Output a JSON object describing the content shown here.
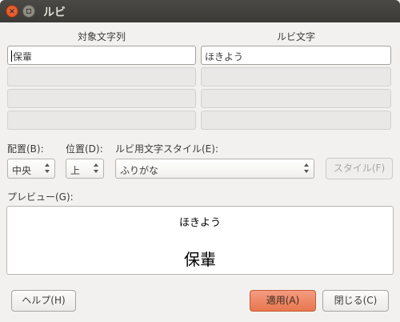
{
  "window": {
    "title": "ルビ",
    "close_glyph": "×"
  },
  "columns": {
    "target_header": "対象文字列",
    "ruby_header": "ルビ文字"
  },
  "rows": [
    {
      "target": "保輩",
      "ruby": "ほきよう"
    },
    {
      "target": "",
      "ruby": ""
    },
    {
      "target": "",
      "ruby": ""
    },
    {
      "target": "",
      "ruby": ""
    }
  ],
  "options": {
    "alignment_label": "配置(B):",
    "alignment_value": "中央",
    "position_label": "位置(D):",
    "position_value": "上",
    "style_label": "ルビ用文字スタイル(E):",
    "style_value": "ふりがな",
    "style_button": "スタイル(F)"
  },
  "preview": {
    "label": "プレビュー(G):",
    "ruby_text": "ほきよう",
    "base_text": "保輩"
  },
  "buttons": {
    "help": "ヘルプ(H)",
    "apply": "適用(A)",
    "close": "閉じる(C)"
  },
  "colors": {
    "accent": "#e8774f",
    "titlebar": "#3b3a36"
  }
}
